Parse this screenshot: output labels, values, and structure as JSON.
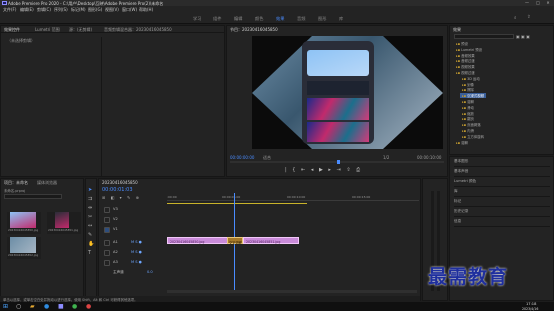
{
  "title_bar": {
    "title": "Adobe Premiere Pro 2020 - C:\\用户\\Desktop\\互映\\Adobe Premiere Pro(2)\\未命名",
    "min": "—",
    "max": "□",
    "close": "✕"
  },
  "menu": [
    "文件(F)",
    "编辑(E)",
    "剪辑(C)",
    "序列(S)",
    "标记(M)",
    "图形(G)",
    "视图(V)",
    "窗口(W)",
    "帮助(H)"
  ],
  "workspaces": [
    "学习",
    "组件",
    "编辑",
    "颜色",
    "效果",
    "音频",
    "图形",
    "库"
  ],
  "active_workspace": "效果",
  "source_panel": {
    "tabs": [
      "效果控件",
      "Lumetri 范围",
      "源：(无剪辑)",
      "音频剪辑混合器：20230416045850"
    ],
    "placeholder": "（未选择剪辑）"
  },
  "program_monitor": {
    "tab": "节目：20230416045850",
    "timecode_left": "00:00:00:00",
    "fit": "适合",
    "scale": "1/2",
    "timecode_right": "00:00:10:00"
  },
  "effects_panel": {
    "tab": "效果",
    "tree": [
      "预设",
      "Lumetri 预设",
      "音频效果",
      "音频过渡",
      "视频效果",
      "视频过渡",
      "3D 运动",
      "划像",
      "擦除",
      "沉浸式视频",
      "溶解",
      "滑动",
      "缩放",
      "翻页",
      "页面剥落",
      "内滑",
      "立方体旋转",
      "溶解"
    ],
    "selected_index": 9,
    "sections": [
      "基本图形",
      "基本声音",
      "Lumetri 颜色",
      "库",
      "标记",
      "历史记录",
      "信息"
    ]
  },
  "project_panel": {
    "tabs": [
      "项目：未命名",
      "媒体浏览器"
    ],
    "path": "未命名.prproj",
    "items": [
      {
        "name": "20230416045850.jpg",
        "duration": "4:29"
      },
      {
        "name": "20230416045851.jpg",
        "duration": "4:29"
      },
      {
        "name": "20230416045852.jpg",
        "duration": "4:29"
      }
    ]
  },
  "timeline": {
    "tab": "20230416045850",
    "timecode": "00:00:01:03",
    "ruler": [
      ":00:00",
      "00:00:05:00",
      "00:00:10:00",
      "00:00:15:00"
    ],
    "video_tracks": [
      "V3",
      "V2",
      "V1"
    ],
    "audio_tracks": [
      "A1",
      "A2",
      "A3"
    ],
    "master": "主声道",
    "master_value": "0.0",
    "clips": [
      {
        "label": "20230416045850.jpg"
      },
      {
        "label": "交叉溶解"
      },
      {
        "label": "20230416045851.jpg"
      }
    ]
  },
  "watermark": "最需教育",
  "status_text": "单击以选择，或单击空白处并拖动以进行选择。使用 Shift、Alt 和 Ctrl 可获得其他选项。",
  "taskbar": {
    "clock": "17:18",
    "date": "2023/4/16"
  }
}
